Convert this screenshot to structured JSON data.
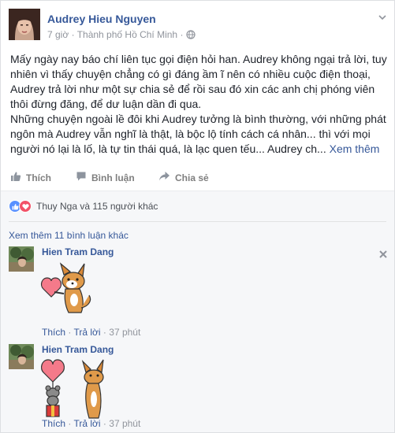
{
  "post": {
    "author": "Audrey Hieu Nguyen",
    "time": "7 giờ",
    "separator": "·",
    "location": "Thành phố Hồ Chí Minh",
    "paragraph1": "Mấy ngày nay báo chí liên tục gọi điện hỏi han. Audrey không ngại trả lời, tuy nhiên vì thấy chuyện chẳng có gì đáng ầm ĩ nên có nhiều cuộc điện thoại, Audrey trả lời như một sự chia sẻ để rồi sau đó xin các anh chị phóng viên thôi đừng đăng, để dư luận dần đi qua.",
    "paragraph2": "Những chuyện ngoài lề đôi khi Audrey tưởng là bình thường, với những phát ngôn mà Audrey vẫn nghĩ là thật, là bộc lộ tính cách cá nhân... thì với mọi người nó lại là lố, là tự tin thái quá, là lạc quen tếu... Audrey ch...",
    "see_more": "Xem thêm"
  },
  "actions": {
    "like": "Thích",
    "comment": "Bình luận",
    "share": "Chia sẻ"
  },
  "reactions": {
    "text": "Thuy Nga và 115 người khác"
  },
  "more_comments": "Xem thêm 11 bình luận khác",
  "comments": [
    {
      "name": "Hien Tram Dang",
      "like": "Thích",
      "dot1": "·",
      "reply": "Trả lời",
      "dot2": "·",
      "time": "37 phút"
    },
    {
      "name": "Hien Tram Dang",
      "like": "Thích",
      "dot1": "·",
      "reply": "Trả lời",
      "dot2": "·",
      "time": "37 phút"
    }
  ],
  "colors": {
    "link": "#365899",
    "meta": "#90949c",
    "like_blue": "#5890ff",
    "love_red": "#f25268"
  },
  "icons": [
    "globe-icon",
    "chevron-down-icon",
    "like-icon",
    "comment-icon",
    "share-icon",
    "close-icon"
  ]
}
